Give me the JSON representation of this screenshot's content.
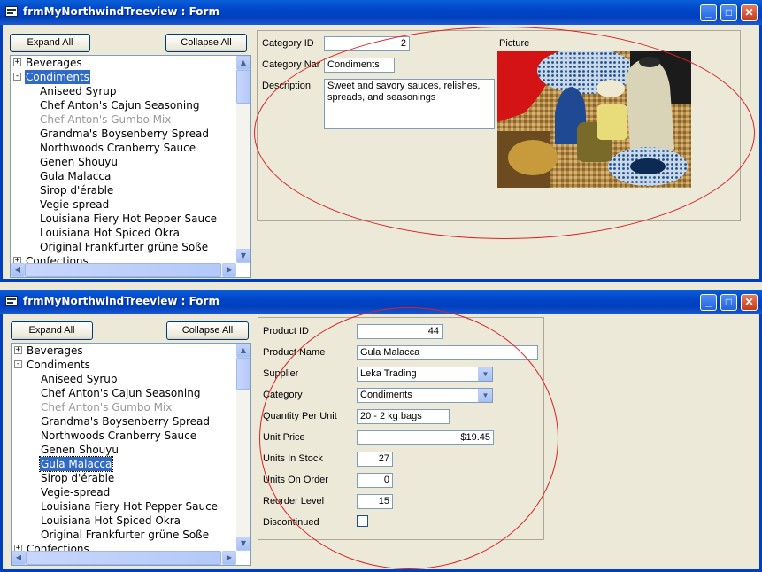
{
  "top_window": {
    "title": "frmMyNorthwindTreeview : Form",
    "expand_all": "Expand All",
    "collapse_all": "Collapse All",
    "tree": [
      {
        "label": "Beverages",
        "level": 0,
        "toggle": "+"
      },
      {
        "label": "Condiments",
        "level": 0,
        "toggle": "-",
        "state": "selected"
      },
      {
        "label": "Aniseed Syrup",
        "level": 1
      },
      {
        "label": "Chef Anton's Cajun Seasoning",
        "level": 1
      },
      {
        "label": "Chef Anton's Gumbo Mix",
        "level": 1,
        "state": "discontinued"
      },
      {
        "label": "Grandma's Boysenberry Spread",
        "level": 1
      },
      {
        "label": "Northwoods Cranberry Sauce",
        "level": 1
      },
      {
        "label": "Genen Shouyu",
        "level": 1
      },
      {
        "label": "Gula Malacca",
        "level": 1
      },
      {
        "label": "Sirop d'érable",
        "level": 1
      },
      {
        "label": "Vegie-spread",
        "level": 1
      },
      {
        "label": "Louisiana Fiery Hot Pepper Sauce",
        "level": 1
      },
      {
        "label": "Louisiana Hot Spiced Okra",
        "level": 1
      },
      {
        "label": "Original Frankfurter grüne Soße",
        "level": 1
      },
      {
        "label": "Confections",
        "level": 0,
        "toggle": "+"
      }
    ],
    "category_id_label": "Category ID",
    "category_id_value": "2",
    "category_name_label": "Category Nan",
    "category_name_value": "Condiments",
    "description_label": "Description",
    "description_value": "Sweet and savory sauces, relishes, spreads, and seasonings",
    "picture_label": "Picture"
  },
  "bottom_window": {
    "title": "frmMyNorthwindTreeview : Form",
    "expand_all": "Expand All",
    "collapse_all": "Collapse All",
    "tree": [
      {
        "label": "Beverages",
        "level": 0,
        "toggle": "+"
      },
      {
        "label": "Condiments",
        "level": 0,
        "toggle": "-"
      },
      {
        "label": "Aniseed Syrup",
        "level": 1
      },
      {
        "label": "Chef Anton's Cajun Seasoning",
        "level": 1
      },
      {
        "label": "Chef Anton's Gumbo Mix",
        "level": 1,
        "state": "discontinued"
      },
      {
        "label": "Grandma's Boysenberry Spread",
        "level": 1
      },
      {
        "label": "Northwoods Cranberry Sauce",
        "level": 1
      },
      {
        "label": "Genen Shouyu",
        "level": 1
      },
      {
        "label": "Gula Malacca",
        "level": 1,
        "state": "selected"
      },
      {
        "label": "Sirop d'érable",
        "level": 1
      },
      {
        "label": "Vegie-spread",
        "level": 1
      },
      {
        "label": "Louisiana Fiery Hot Pepper Sauce",
        "level": 1
      },
      {
        "label": "Louisiana Hot Spiced Okra",
        "level": 1
      },
      {
        "label": "Original Frankfurter grüne Soße",
        "level": 1
      },
      {
        "label": "Confections",
        "level": 0,
        "toggle": "+"
      }
    ],
    "fields": {
      "product_id": {
        "label": "Product ID",
        "value": "44"
      },
      "product_name": {
        "label": "Product Name",
        "value": "Gula Malacca"
      },
      "supplier": {
        "label": "Supplier",
        "value": "Leka Trading"
      },
      "category": {
        "label": "Category",
        "value": "Condiments"
      },
      "quantity_per_unit": {
        "label": "Quantity Per Unit",
        "value": "20 - 2 kg bags"
      },
      "unit_price": {
        "label": "Unit Price",
        "value": "$19.45"
      },
      "units_in_stock": {
        "label": "Units In Stock",
        "value": "27"
      },
      "units_on_order": {
        "label": "Units On Order",
        "value": "0"
      },
      "reorder_level": {
        "label": "Reorder Level",
        "value": "15"
      },
      "discontinued": {
        "label": "Discontinued",
        "checked": false
      }
    }
  },
  "colors": {
    "selection": "#316ac5",
    "annotation_ellipse": "#d22222",
    "titlebar": "#0040be"
  }
}
